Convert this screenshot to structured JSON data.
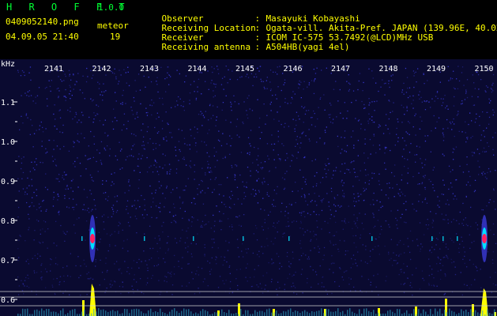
{
  "app": {
    "title": "H R O F F T",
    "version": "1.0.0",
    "filename": "0409052140.png",
    "datetime": "04.09.05 21:40"
  },
  "meteor": {
    "label": "meteor",
    "count": "19"
  },
  "info": [
    {
      "key": "Observer",
      "value": "Masayuki Kobayashi"
    },
    {
      "key": "Receiving Location",
      "value": "Ogata-vill. Akita-Pref. JAPAN (139.96E, 40.02N)"
    },
    {
      "key": "Receiver",
      "value": "ICOM IC-575 53.7492(@LCD)MHz USB"
    },
    {
      "key": "Receiving antenna",
      "value": "A504HB(yagi 4el)"
    }
  ],
  "spectrogram": {
    "y_unit": "kHz",
    "y_ticks": [
      "1.1",
      "1.0",
      "0.9",
      "0.8",
      "0.7",
      "0.6"
    ],
    "x_ticks": [
      "2141",
      "2142",
      "2143",
      "2144",
      "2145",
      "2146",
      "2147",
      "2148",
      "2149",
      "2150"
    ],
    "colors": {
      "background": "#0a0a30",
      "noise": "#3a3ad8",
      "signal_hot": "#ff2060",
      "signal_edge": "#00e0ff",
      "bars": "#ffff00",
      "axis": "#ffffff"
    }
  }
}
